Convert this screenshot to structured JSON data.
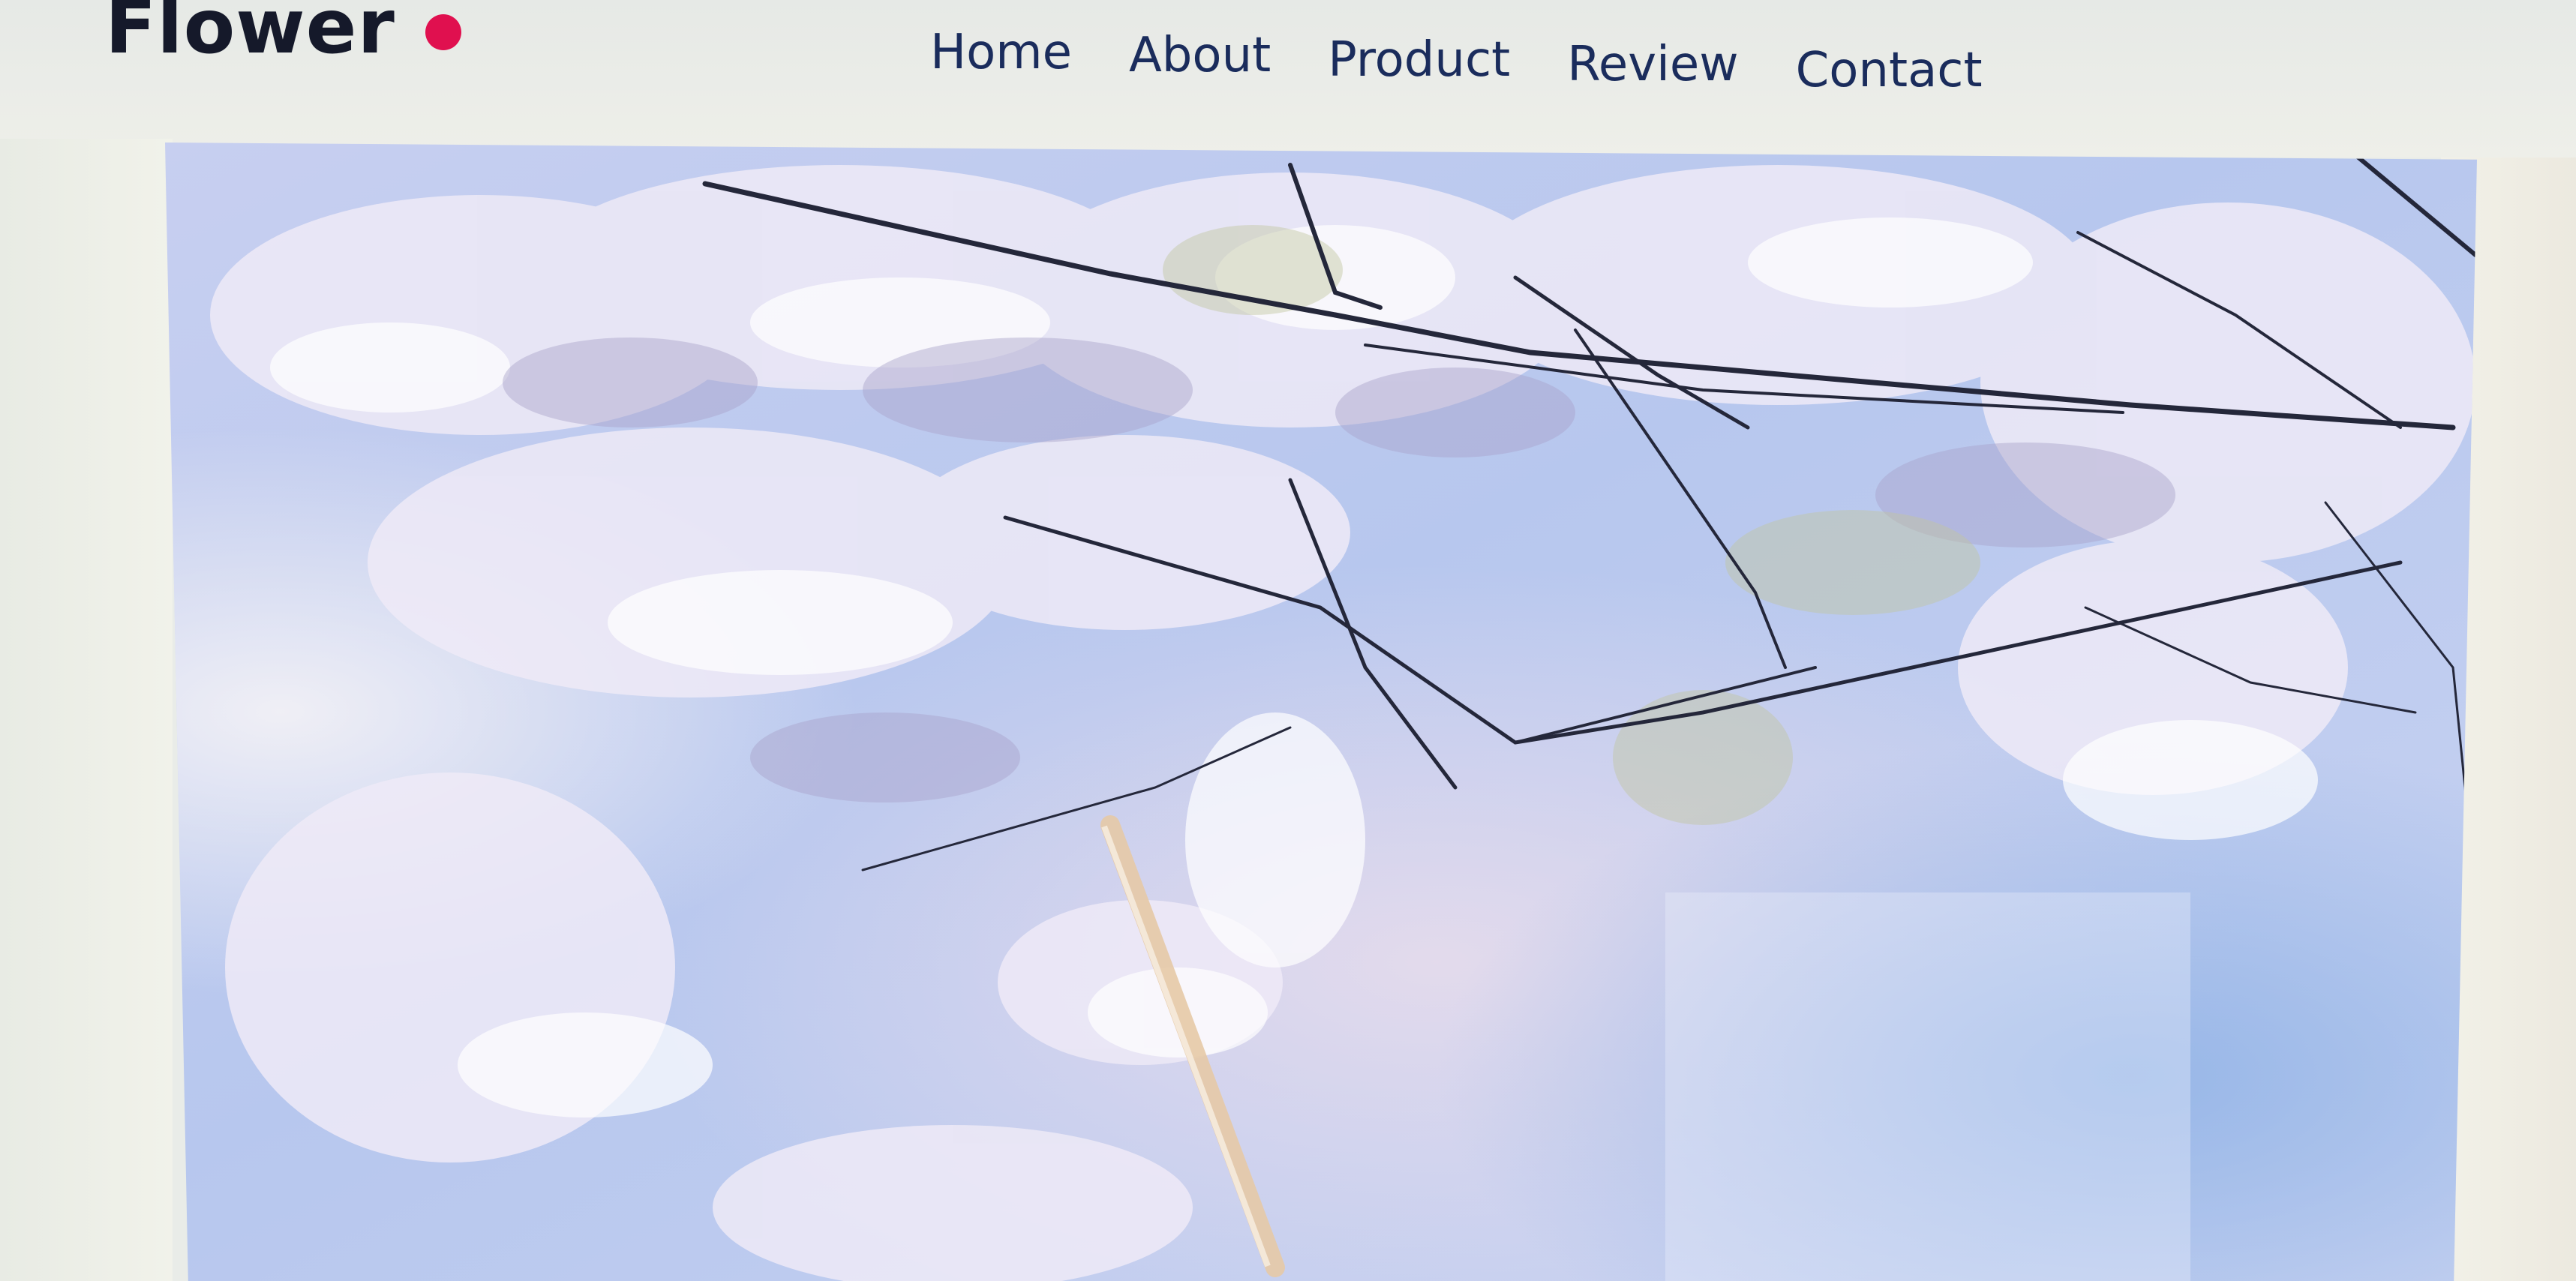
{
  "brand": {
    "name": "Flower",
    "accent_color": "#e0104f"
  },
  "nav": {
    "items": [
      {
        "label": "Home"
      },
      {
        "label": "About"
      },
      {
        "label": "Product"
      },
      {
        "label": "Review"
      },
      {
        "label": "Contact"
      }
    ]
  },
  "hero": {
    "image_subject": "white blossom branches against a pale blue sky"
  }
}
